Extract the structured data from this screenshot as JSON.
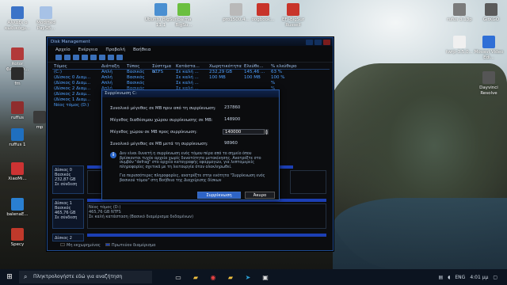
{
  "desktop_icons": [
    {
      "label": "Αλλαξε ο\nκωδικόςμ...",
      "color": "#3b73c8"
    },
    {
      "label": "Modified\nPaySB...",
      "color": "#a7c2e6"
    },
    {
      "label": "Ubuntu\nBigSur 11.1",
      "color": "#4a8fd1"
    },
    {
      "label": "ibalma\nBigSu...",
      "color": "#6bbf3f"
    },
    {
      "label": "pro1500.4...",
      "color": "#b9b9b9"
    },
    {
      "label": "oogbook...",
      "color": "#c8342a"
    },
    {
      "label": "EFI-BigSur\nRussell",
      "color": "#c8342a"
    },
    {
      "label": "rufus 3.13p",
      "color": "#7b7b7b"
    },
    {
      "label": "GitKGO",
      "color": "#5a5a5a"
    },
    {
      "label": "Rotor\nΦΑΚΕΛΟ...",
      "color": "#b23a3a"
    },
    {
      "label": "fm",
      "color": "#2b2b2b"
    },
    {
      "label": "ruffus",
      "color": "#8f2d2d"
    },
    {
      "label": "mp",
      "color": "#3a3a3a"
    },
    {
      "label": "ruffus 1",
      "color": "#1f6fbf"
    },
    {
      "label": "XiaoMi...",
      "color": "#c33"
    },
    {
      "label": "balenaE...",
      "color": "#2a7fd1"
    },
    {
      "label": "Specy",
      "color": "#c0392b"
    },
    {
      "label": "twrp-3.5.0...",
      "color": "#f0f0f0"
    },
    {
      "label": "Movavi\nVideo Edi...",
      "color": "#2f6fd6"
    },
    {
      "label": "Dayvinci\nResolve",
      "color": "#555"
    }
  ],
  "window": {
    "title": "Disk Management",
    "menu": [
      "Αρχείο",
      "Ενέργεια",
      "Προβολή",
      "Βοήθεια"
    ],
    "columns": [
      "Τόμος",
      "Διάταξη",
      "Τύπος",
      "Σύστημα α...",
      "Κατάστα...",
      "Χωρητικότητα",
      "Ελεύθε...",
      "% ελεύθερο"
    ],
    "rows": [
      [
        "(C:)",
        "Απλή",
        "Βασικός",
        "NTFS",
        "Σε καλή ...",
        "232,29 GB",
        "145,46 ...",
        "63 %"
      ],
      [
        "(Δίσκος 0 Διαμ...",
        "Απλή",
        "Βασικός",
        "",
        "Σε καλή ...",
        "100 MB",
        "100 MB",
        "100 %"
      ],
      [
        "(Δίσκος 0 Διαμ...",
        "Απλή",
        "Βασικός",
        "",
        "Σε καλή ...",
        "",
        "",
        "%"
      ],
      [
        "(Δίσκος 2 Διαμ...",
        "Απλή",
        "Βασικός",
        "",
        "Σε καλή ...",
        "",
        "",
        "%"
      ],
      [
        "(Δίσκος 2 Διαμ...",
        "Απλή",
        "Βασικός",
        "",
        "Σε καλή ...",
        "",
        "",
        "%"
      ],
      [
        "(Δίσκος 1 Διαμ...",
        "Απλή",
        "Βασικός",
        "",
        "Σε καλή ...",
        "",
        "",
        "%"
      ],
      [
        "Νέος τόμος (D:)",
        "Απλή",
        "Βασικός",
        "",
        "Σε καλή ...",
        "",
        "",
        "%"
      ]
    ],
    "disks": [
      {
        "name": "Δίσκος 0",
        "type": "Βασικός",
        "size": "232,87 GB",
        "status": "Σε σύνδεση"
      },
      {
        "name": "Δίσκος 1",
        "type": "Βασικός",
        "size": "465,76 GB",
        "status": "Σε σύνδεση"
      },
      {
        "name": "Δίσκος 2",
        "type": "",
        "size": "",
        "status": ""
      }
    ],
    "disk1_partition": {
      "title": "Νέος τόμος (D:)",
      "size": "465,76 GB NTFS",
      "status": "Σε καλή κατάσταση (Βασικό διαμέρισμα δεδομένων)"
    },
    "legend": [
      "Μη εκχωρημένος",
      "Πρωτεύον διαμέρισμα"
    ]
  },
  "dialog": {
    "title": "Συρρίκνωση C:",
    "fields": [
      {
        "label": "Συνολικό μέγεθος σε MB πριν από τη συρρίκνωση:",
        "value": "237860"
      },
      {
        "label": "Μέγεθος διαθέσιμου χώρου συρρίκνωσης σε MB:",
        "value": "148900"
      },
      {
        "label": "Μέγεθος χώρου σε MB προς συρρίκνωση:",
        "value": "140000"
      },
      {
        "label": "Συνολικό μέγεθος σε MB μετά τη συρρίκνωση:",
        "value": "98960"
      }
    ],
    "info": "Δεν είναι δυνατή η συρρίκνωση ενός τόμου πέρα από το σημείο όπου βρίσκονται τυχόν αρχεία χωρίς δυνατότητα μετακίνησης. Ανατρέξτε στο συμβάν \"defrag\" στο αρχείο καταγραφής εφαρμογών, για λεπτομερείς πληροφορίες σχετικά με τη λειτουργία όταν ολοκληρωθεί.",
    "note": "Για περισσότερες πληροφορίες, ανατρέξτε στην ενότητα \"Συρρίκνωση ενός βασικού τόμου\" στη Βοήθεια της Διαχείρισης δίσκων",
    "primary": "Συρρίκνωση",
    "cancel": "Άκυρο"
  },
  "taskbar": {
    "search_placeholder": "Πληκτρολογήστε εδώ για αναζήτηση",
    "lang": "ENG",
    "time": "4:01 μμ"
  }
}
